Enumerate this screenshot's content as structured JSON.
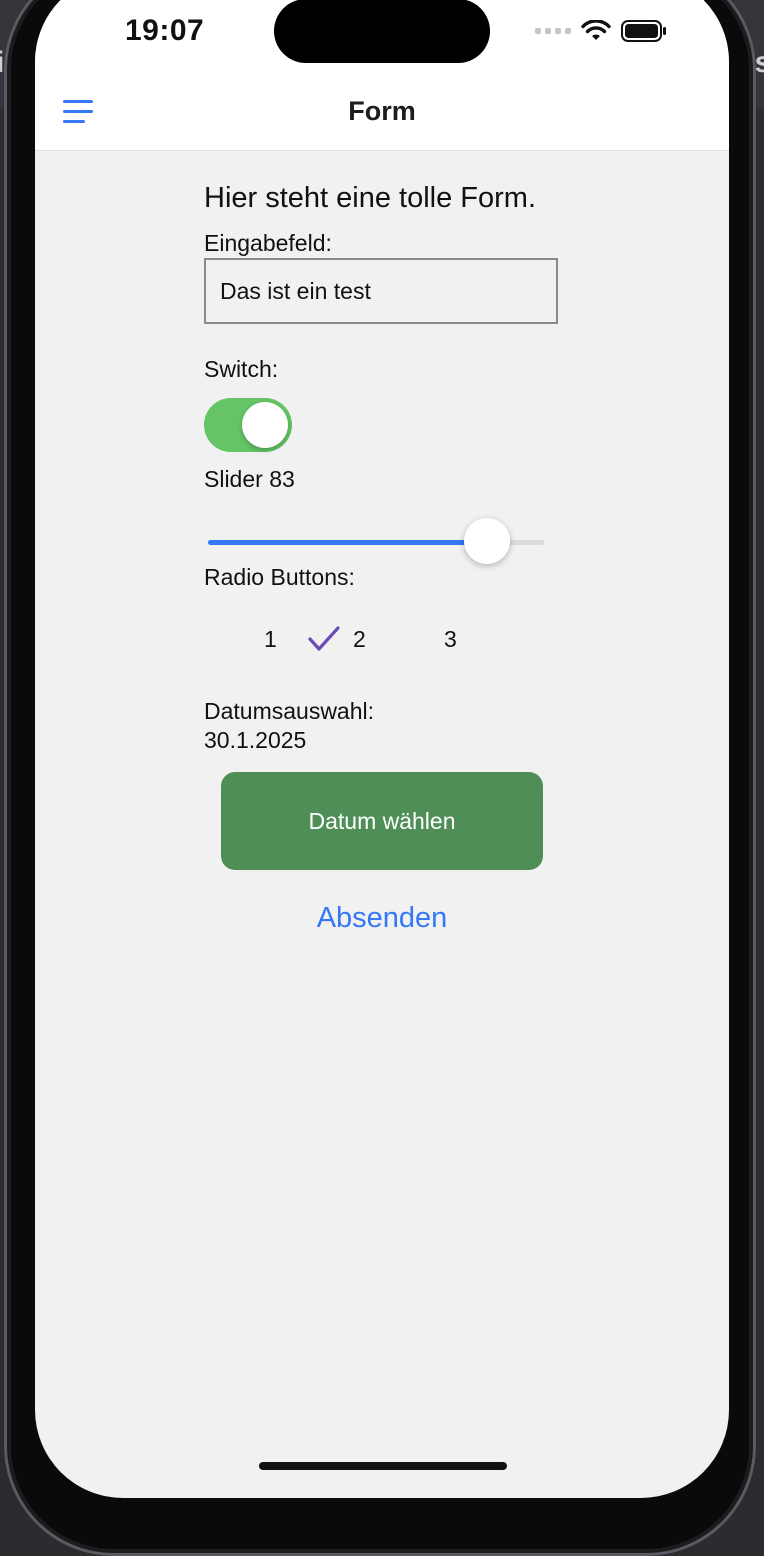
{
  "status_bar": {
    "time": "19:07"
  },
  "nav": {
    "title": "Form"
  },
  "form": {
    "intro": "Hier steht eine tolle Form.",
    "input_label": "Eingabefeld:",
    "input_value": "Das ist ein test",
    "switch_label": "Switch:",
    "switch_on": true,
    "slider_label": "Slider 83",
    "slider_value": 83,
    "slider_max": 100,
    "radio_label": "Radio Buttons:",
    "radio_options": [
      "1",
      "2",
      "3"
    ],
    "radio_selected": "2",
    "date_label": "Datumsauswahl:",
    "date_value": "30.1.2025",
    "date_button": "Datum wählen",
    "submit_button": "Absenden"
  },
  "colors": {
    "accent": "#3478f6",
    "switch_on": "#65c466",
    "date_button": "#4f8f57",
    "check": "#6a4bb3",
    "background": "#f1f1f1"
  }
}
